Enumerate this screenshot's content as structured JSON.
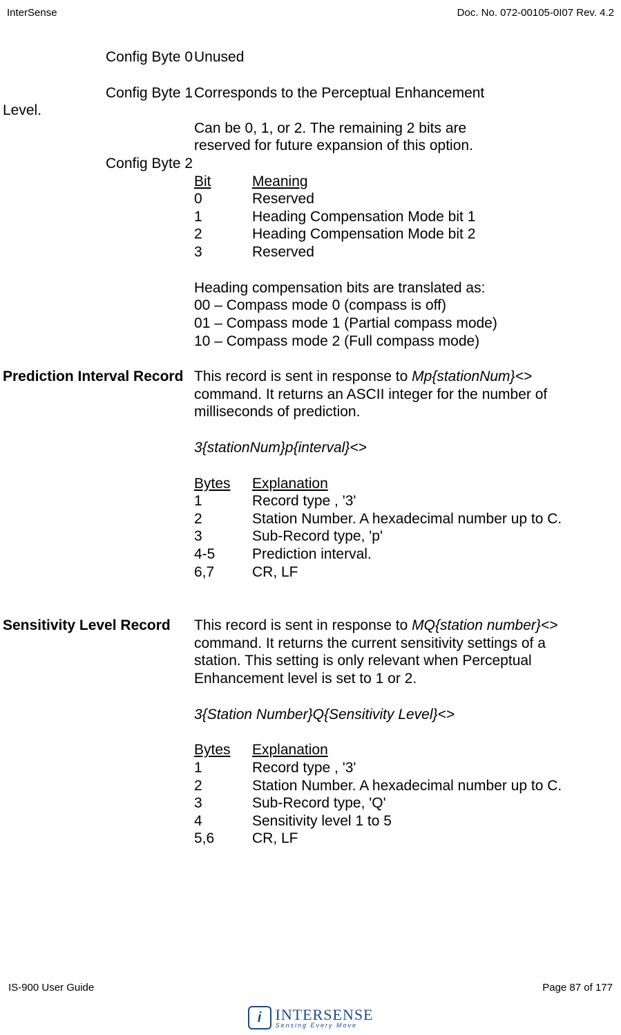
{
  "header": {
    "left": "InterSense",
    "right": "Doc. No. 072-00105-0I07 Rev. 4.2"
  },
  "config_byte_0": {
    "label": "Config Byte 0",
    "value": "Unused"
  },
  "config_byte_1": {
    "label": "Config Byte 1",
    "line1": "Corresponds to the Perceptual Enhancement",
    "level_word": "Level.",
    "line2": "Can be 0, 1, or 2. The remaining 2 bits are",
    "line3": "reserved for future expansion of this option."
  },
  "config_byte_2": {
    "label": "Config Byte 2",
    "header_bit": "Bit",
    "header_meaning": "Meaning",
    "rows": [
      {
        "bit": "0",
        "meaning": "Reserved"
      },
      {
        "bit": "1",
        "meaning": "Heading Compensation Mode bit 1"
      },
      {
        "bit": "2",
        "meaning": "Heading Compensation Mode bit 2"
      },
      {
        "bit": "3",
        "meaning": "Reserved"
      }
    ],
    "translated_intro": "Heading compensation bits are translated as:",
    "t0": "00 – Compass mode 0 (compass is off)",
    "t1": "01 – Compass mode 1 (Partial compass mode)",
    "t2": "10 – Compass mode 2 (Full compass mode)"
  },
  "prediction": {
    "title": "Prediction Interval Record",
    "desc_pre": "This record is sent in response to ",
    "desc_cmd": "Mp{stationNum}<>",
    "desc_post1": "command. It returns an ASCII integer for the number of",
    "desc_post2": "milliseconds of prediction.",
    "format": "3{stationNum}p{interval}<>",
    "header_bytes": "Bytes",
    "header_expl": "Explanation",
    "rows": [
      {
        "b": "1",
        "e": "Record type , '3'"
      },
      {
        "b": "2",
        "e": "Station Number. A hexadecimal number up to C."
      },
      {
        "b": "3",
        "e": "Sub-Record type, 'p'"
      },
      {
        "b": "4-5",
        "e": "Prediction interval."
      },
      {
        "b": "6,7",
        "e": "CR, LF"
      }
    ]
  },
  "sensitivity": {
    "title": "Sensitivity Level Record",
    "desc_pre": "This record is sent in response to ",
    "desc_cmd": "MQ{station number}<>",
    "desc_post1": "command. It returns the current sensitivity settings of a",
    "desc_post2": "station. This setting is only relevant when Perceptual",
    "desc_post3": "Enhancement level is set to 1 or 2.",
    "format": "3{Station Number}Q{Sensitivity Level}<>",
    "header_bytes": "Bytes",
    "header_expl": "Explanation",
    "rows": [
      {
        "b": "1",
        "e": "Record type , '3'"
      },
      {
        "b": "2",
        "e": "Station Number. A hexadecimal number up to C."
      },
      {
        "b": "3",
        "e": "Sub-Record type, 'Q'"
      },
      {
        "b": "4",
        "e": "Sensitivity level 1 to 5"
      },
      {
        "b": "5,6",
        "e": "CR, LF"
      }
    ]
  },
  "footer": {
    "left": "IS-900 User Guide",
    "right": "Page 87 of 177"
  },
  "logo": {
    "main": "INTERSENSE",
    "sub": "Sensing Every Move"
  }
}
